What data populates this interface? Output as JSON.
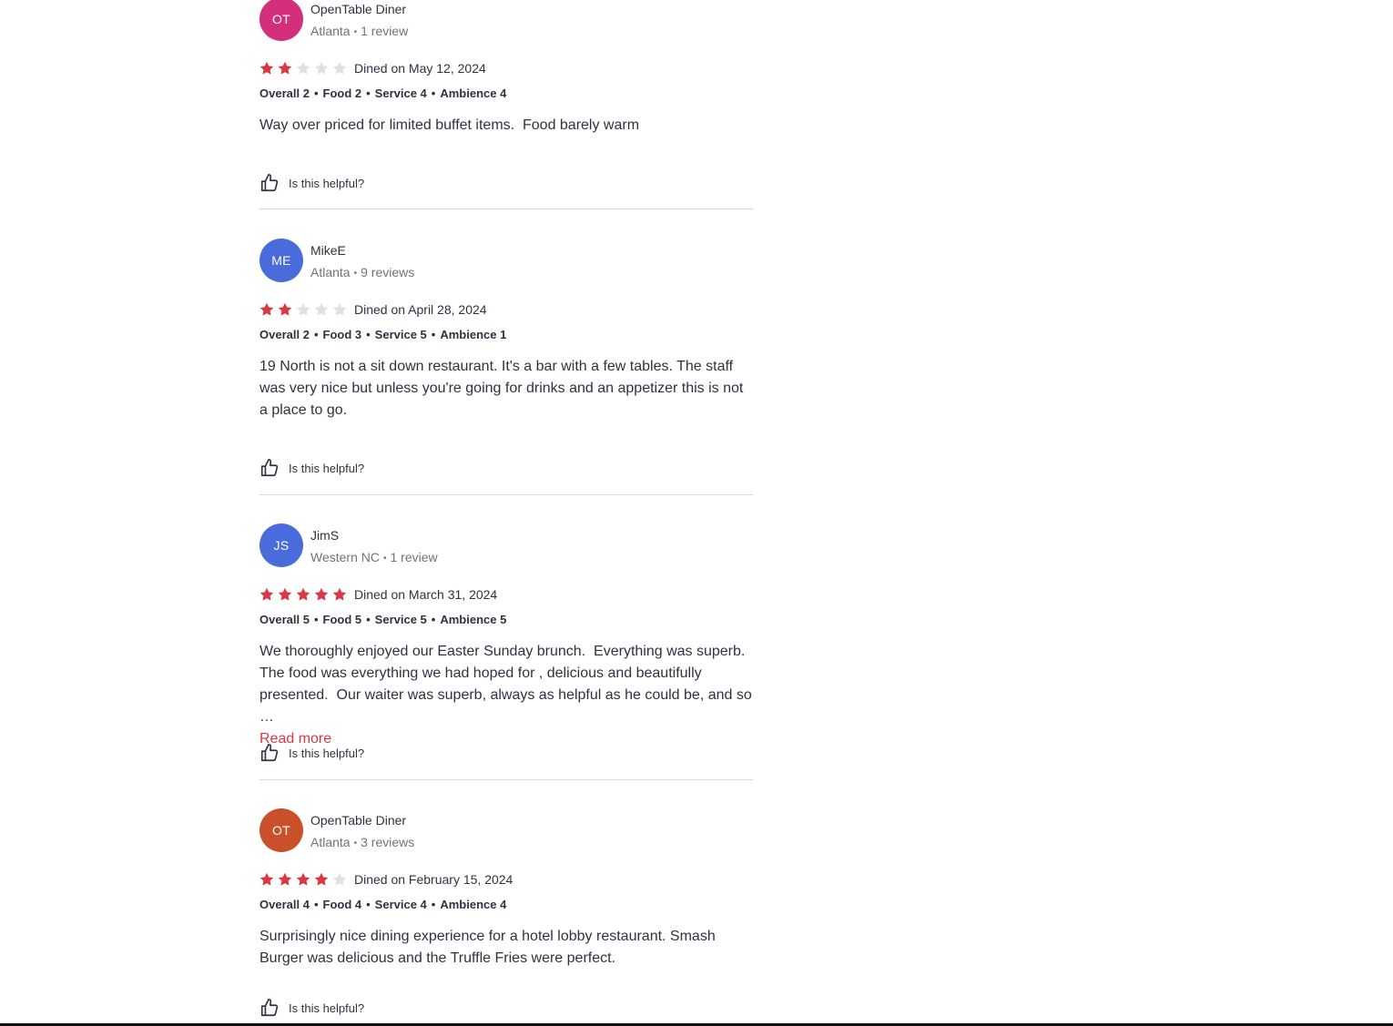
{
  "reviews": [
    {
      "initials": "OT",
      "avatar_color": "#d32f7b",
      "name": "OpenTable Diner",
      "location": "Atlanta",
      "review_count": "1 review",
      "stars": 2,
      "dined": "Dined on May 12, 2024",
      "overall": "Overall 2",
      "food": "Food 2",
      "service": "Service 4",
      "ambience": "Ambience 4",
      "text": "Way over priced for limited buffet items.  Food barely warm",
      "read_more": "",
      "helpful": "Is this helpful?"
    },
    {
      "initials": "ME",
      "avatar_color": "#4a6bdc",
      "name": "MikeE",
      "location": "Atlanta",
      "review_count": "9 reviews",
      "stars": 2,
      "dined": "Dined on April 28, 2024",
      "overall": "Overall 2",
      "food": "Food 3",
      "service": "Service 5",
      "ambience": "Ambience 1",
      "text": "19 North is not a sit down restaurant. It's a bar with a few tables. The staff was very nice but unless you're going for drinks and an appetizer this is not a place to go.",
      "read_more": "",
      "helpful": "Is this helpful?"
    },
    {
      "initials": "JS",
      "avatar_color": "#4a6bdc",
      "name": "JimS",
      "location": "Western NC",
      "review_count": "1 review",
      "stars": 5,
      "dined": "Dined on March 31, 2024",
      "overall": "Overall 5",
      "food": "Food 5",
      "service": "Service 5",
      "ambience": "Ambience 5",
      "text": "We thoroughly enjoyed our Easter Sunday brunch.  Everything was superb.  The food was everything we had hoped for , delicious and beautifully presented.  Our waiter was superb, always as helpful as he could be, and so …",
      "read_more": "Read more",
      "helpful": "Is this helpful?"
    },
    {
      "initials": "OT",
      "avatar_color": "#c9502a",
      "name": "OpenTable Diner",
      "location": "Atlanta",
      "review_count": "3 reviews",
      "stars": 4,
      "dined": "Dined on February 15, 2024",
      "overall": "Overall 4",
      "food": "Food 4",
      "service": "Service 4",
      "ambience": "Ambience 4",
      "text": "Surprisingly nice dining experience for a hotel lobby restaurant. Smash Burger was delicious and the Truffle Fries were perfect.",
      "read_more": "",
      "helpful": "Is this helpful?"
    }
  ],
  "colors": {
    "star_filled": "#da3743",
    "star_empty": "#e1e1e1",
    "accent": "#da3743"
  }
}
